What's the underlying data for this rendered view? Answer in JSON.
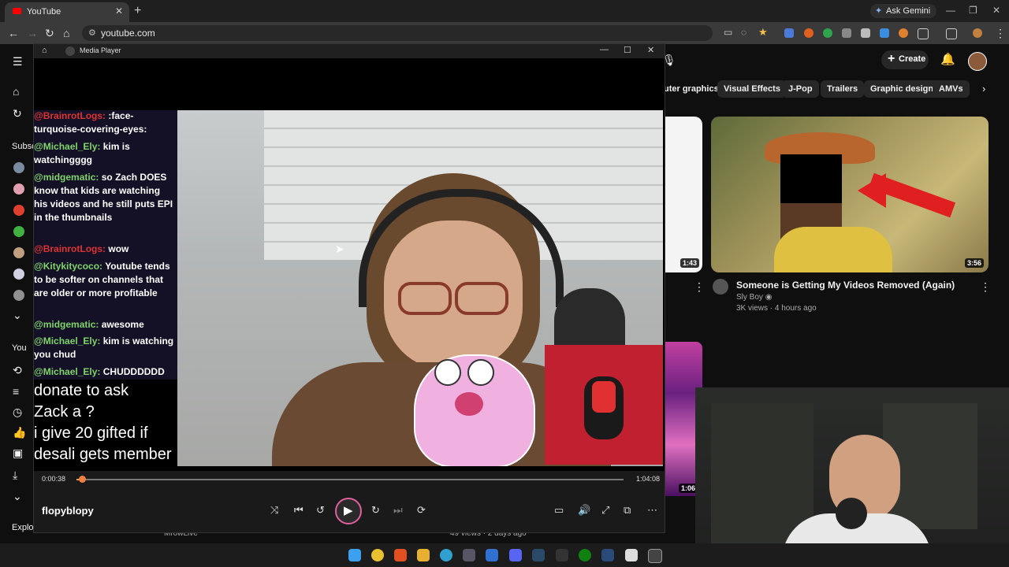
{
  "browser": {
    "tab_title": "YouTube",
    "new_tab": "+",
    "ask_gemini": "Ask Gemini",
    "url": "youtube.com"
  },
  "youtube": {
    "chips": [
      "uter graphics",
      "Visual Effects",
      "J-Pop",
      "Trailers",
      "Graphic design",
      "AMVs"
    ],
    "create_label": "Create",
    "sidebar_labels": {
      "subscriptions": "Subsc",
      "you": "You",
      "explore": "Explo"
    },
    "video": {
      "title": "Someone is Getting My Videos Removed (Again)",
      "channel": "Sly Boy",
      "meta": "3K views · 4 hours ago",
      "duration": "3:56"
    },
    "left_duration": "1:43",
    "third_duration": "1:06",
    "below_channel": "MrowLive",
    "below_meta": "49 views · 2 days ago"
  },
  "player": {
    "window_title": "Media Player",
    "current_time": "0:00:38",
    "total_time": "1:04:08",
    "progress_fraction": 0.01,
    "media_title": "flopyblopy"
  },
  "chat": [
    {
      "user": "@BrainrotLogs:",
      "msg": ":face-turquoise-covering-eyes:",
      "color": "red"
    },
    {
      "user": "@Michael_Ely:",
      "msg": "kim is watchingggg",
      "color": "green"
    },
    {
      "user": "@midgematic:",
      "msg": "so Zach DOES know that kids are watching his videos and he still puts EPI in the thumbnails",
      "color": "green"
    },
    {
      "user": "@BrainrotLogs:",
      "msg": "wow",
      "color": "red"
    },
    {
      "user": "@Kitykitycoco:",
      "msg": "Youtube tends to be softer on channels that are older or more profitable",
      "color": "green"
    },
    {
      "user": "@midgematic:",
      "msg": "awesome",
      "color": "green"
    },
    {
      "user": "@Michael_Ely:",
      "msg": "kim is watching you chud",
      "color": "green"
    },
    {
      "user": "@Michael_Ely:",
      "msg": "CHUDDDDDD",
      "color": "green"
    }
  ],
  "overlay_text": {
    "line1": "donate to ask",
    "line2": "Zack a ?",
    "line3": "i give 20 gifted if",
    "line4": "desali gets member"
  },
  "colors": {
    "seek_fill": "#f08040",
    "play_ring": "#e060a0",
    "chat_user": "#7fd46a"
  }
}
